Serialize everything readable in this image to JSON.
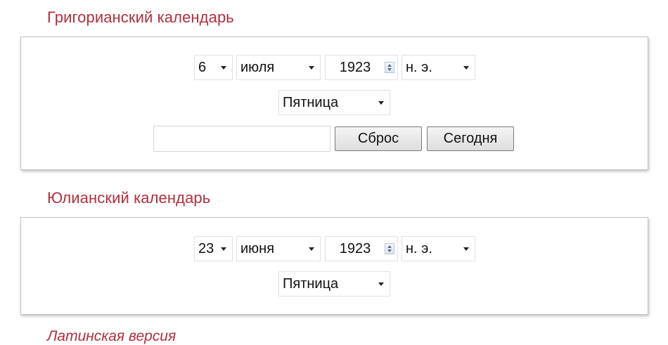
{
  "gregorian": {
    "title": "Григорианский календарь",
    "day": "6",
    "month": "июля",
    "year": "1923",
    "era": "н. э.",
    "weekday": "Пятница",
    "date_input_value": "",
    "reset_label": "Сброс",
    "today_label": "Сегодня"
  },
  "julian": {
    "title": "Юлианский календарь",
    "day": "23",
    "month": "июня",
    "year": "1923",
    "era": "н. э.",
    "weekday": "Пятница"
  },
  "footer": {
    "latin_link": "Латинская версия"
  },
  "colors": {
    "accent": "#b0303c"
  },
  "icons": {
    "dropdown": "chevron-down-icon",
    "spinner": "spin-buttons-icon"
  }
}
